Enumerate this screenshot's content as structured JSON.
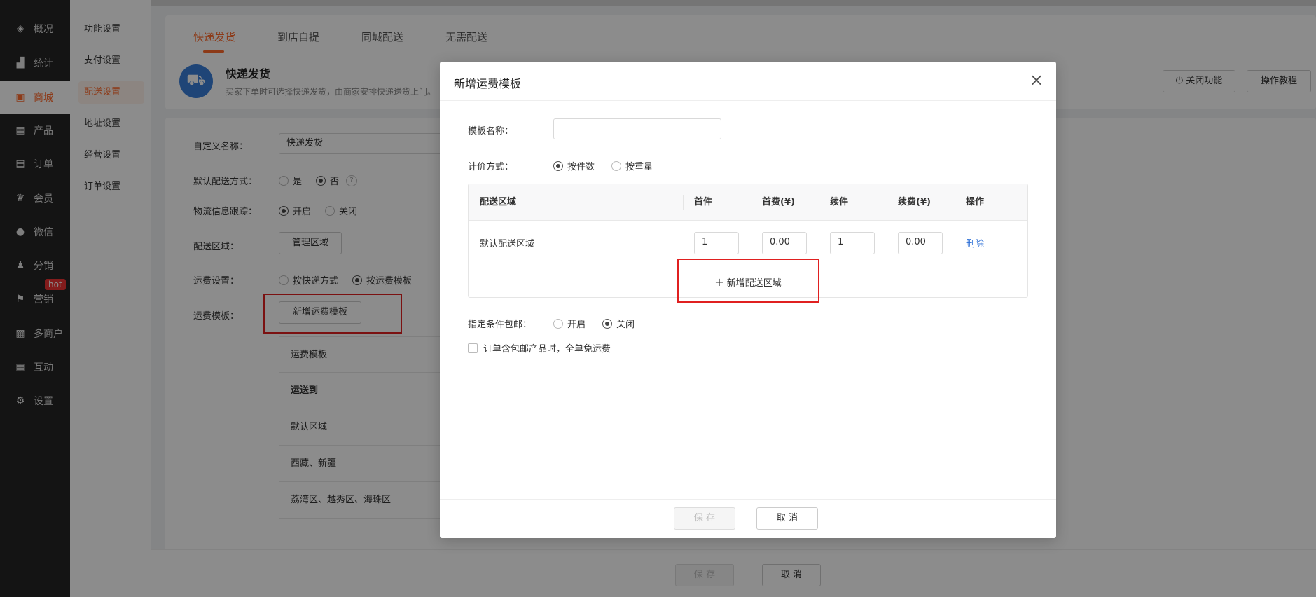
{
  "sidebar": {
    "items": [
      {
        "label": "概况",
        "icon": "layers-icon"
      },
      {
        "label": "统计",
        "icon": "chart-icon"
      },
      {
        "label": "商城",
        "icon": "shop-icon"
      },
      {
        "label": "产品",
        "icon": "grid-icon"
      },
      {
        "label": "订单",
        "icon": "clipboard-icon"
      },
      {
        "label": "会员",
        "icon": "crown-icon"
      },
      {
        "label": "微信",
        "icon": "wechat-icon"
      },
      {
        "label": "分销",
        "icon": "users-icon"
      },
      {
        "label": "营销",
        "icon": "flag-icon"
      },
      {
        "label": "多商户",
        "icon": "store-icon"
      },
      {
        "label": "互动",
        "icon": "apps-icon"
      },
      {
        "label": "设置",
        "icon": "gear-icon"
      }
    ],
    "hot_badge": "hot"
  },
  "subnav": {
    "items": [
      "功能设置",
      "支付设置",
      "配送设置",
      "地址设置",
      "经营设置",
      "订单设置"
    ]
  },
  "tabs": [
    "快递发货",
    "到店自提",
    "同城配送",
    "无需配送"
  ],
  "hero": {
    "title": "快递发货",
    "desc": "买家下单时可选择快递发货，由商家安排快递送货上门。"
  },
  "top_buttons": {
    "close_feature": "关闭功能",
    "tutorial": "操作教程"
  },
  "form": {
    "custom_name_label": "自定义名称：",
    "custom_name_value": "快递发货",
    "default_method_label": "默认配送方式：",
    "yes": "是",
    "no": "否",
    "q": "?",
    "tracking_label": "物流信息跟踪：",
    "on": "开启",
    "off": "关闭",
    "area_label": "配送区域：",
    "manage_area": "管理区域",
    "fee_label": "运费设置：",
    "by_express": "按快递方式",
    "by_template": "按运费模板",
    "template_label": "运费模板：",
    "add_template": "新增运费模板",
    "bg_rows": [
      "运费模板",
      "运送到",
      "默认区域",
      "西藏、新疆",
      "荔湾区、越秀区、海珠区"
    ],
    "save": "保 存",
    "cancel": "取 消"
  },
  "modal": {
    "title": "新增运费模板",
    "close": "×",
    "name_label": "模板名称：",
    "name_value": "",
    "pricing_label": "计价方式：",
    "by_count": "按件数",
    "by_weight": "按重量",
    "table": {
      "headers": [
        "配送区域",
        "首件",
        "首费(¥)",
        "续件",
        "续费(¥)",
        "操作"
      ],
      "row": {
        "area": "默认配送区域",
        "first": "1",
        "first_fee": "0.00",
        "next": "1",
        "next_fee": "0.00",
        "action": "删除"
      }
    },
    "add_area": "新增配送区域",
    "plus": "+",
    "free_label": "指定条件包邮：",
    "on": "开启",
    "off": "关闭",
    "checkbox_text": "订单含包邮产品时，全单免运费",
    "save": "保 存",
    "cancel": "取 消"
  }
}
